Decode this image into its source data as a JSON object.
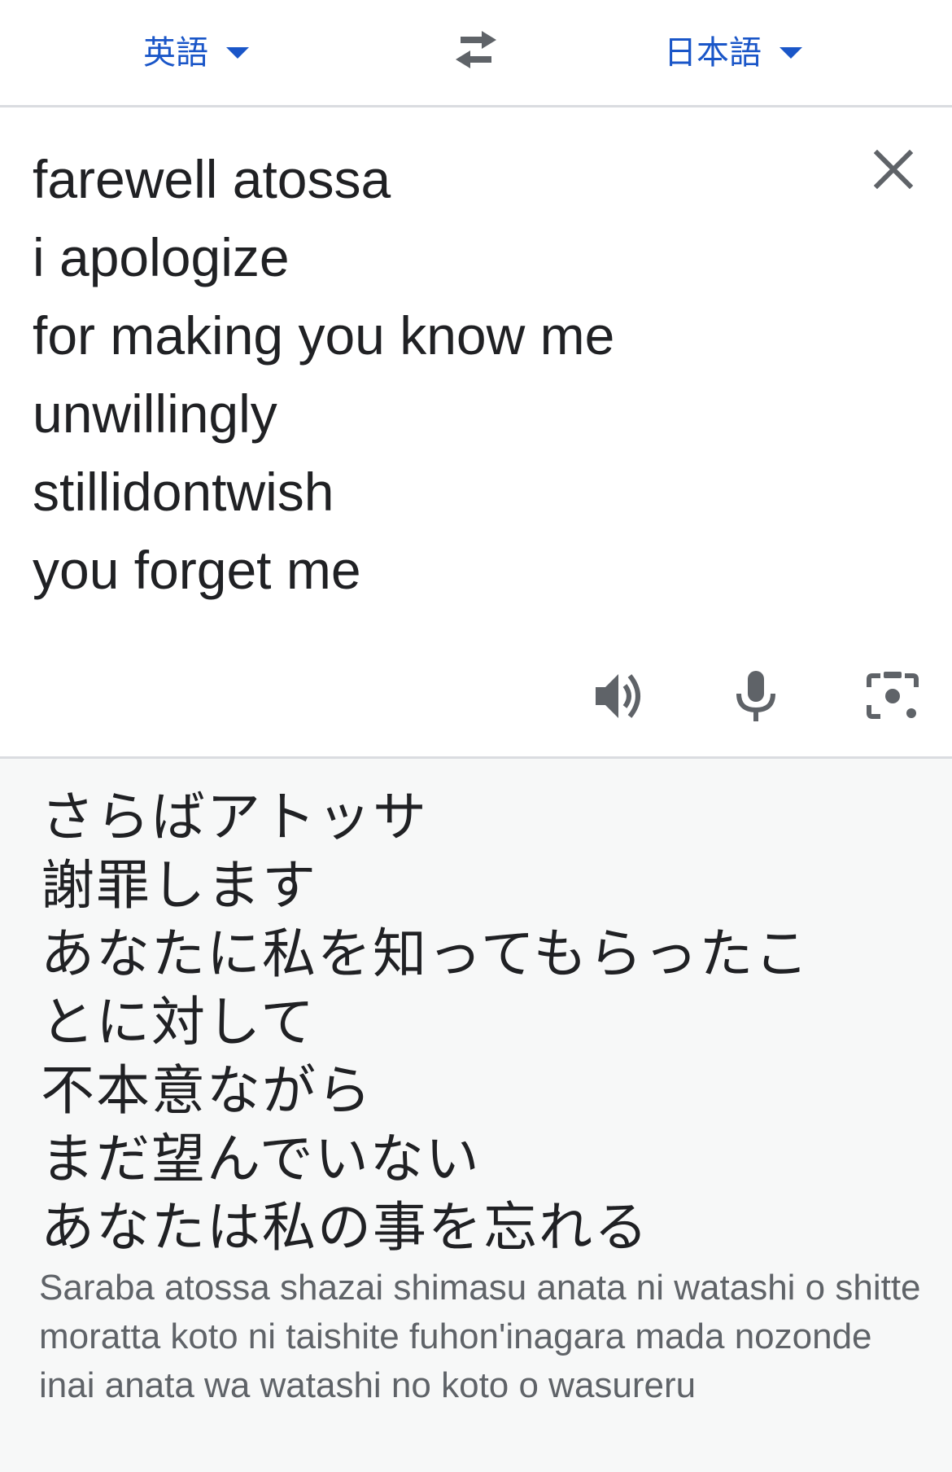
{
  "language_bar": {
    "source_language": "英語",
    "target_language": "日本語",
    "swap_icon": "swap-arrows-icon",
    "dropdown_icon": "caret-down-icon",
    "accent_color": "#1a56c8"
  },
  "source": {
    "lines": [
      "farewell atossa",
      "i apologize",
      "for making you know me",
      "unwillingly",
      "stillidontwish",
      "you forget me"
    ],
    "clear_icon": "close-icon",
    "tools": [
      "speaker-icon",
      "microphone-icon",
      "camera-icon"
    ]
  },
  "translation": {
    "lines": [
      "さらばアトッサ",
      "謝罪します",
      "あなたに私を知ってもらったこ",
      "とに対して",
      "不本意ながら",
      "まだ望んでいない",
      "あなたは私の事を忘れる"
    ],
    "romanization": "Saraba atossa shazai shimasu anata ni watashi o shitte moratta koto ni taishite fuhon'inagara mada nozonde inai anata wa watashi no koto o wasureru"
  }
}
